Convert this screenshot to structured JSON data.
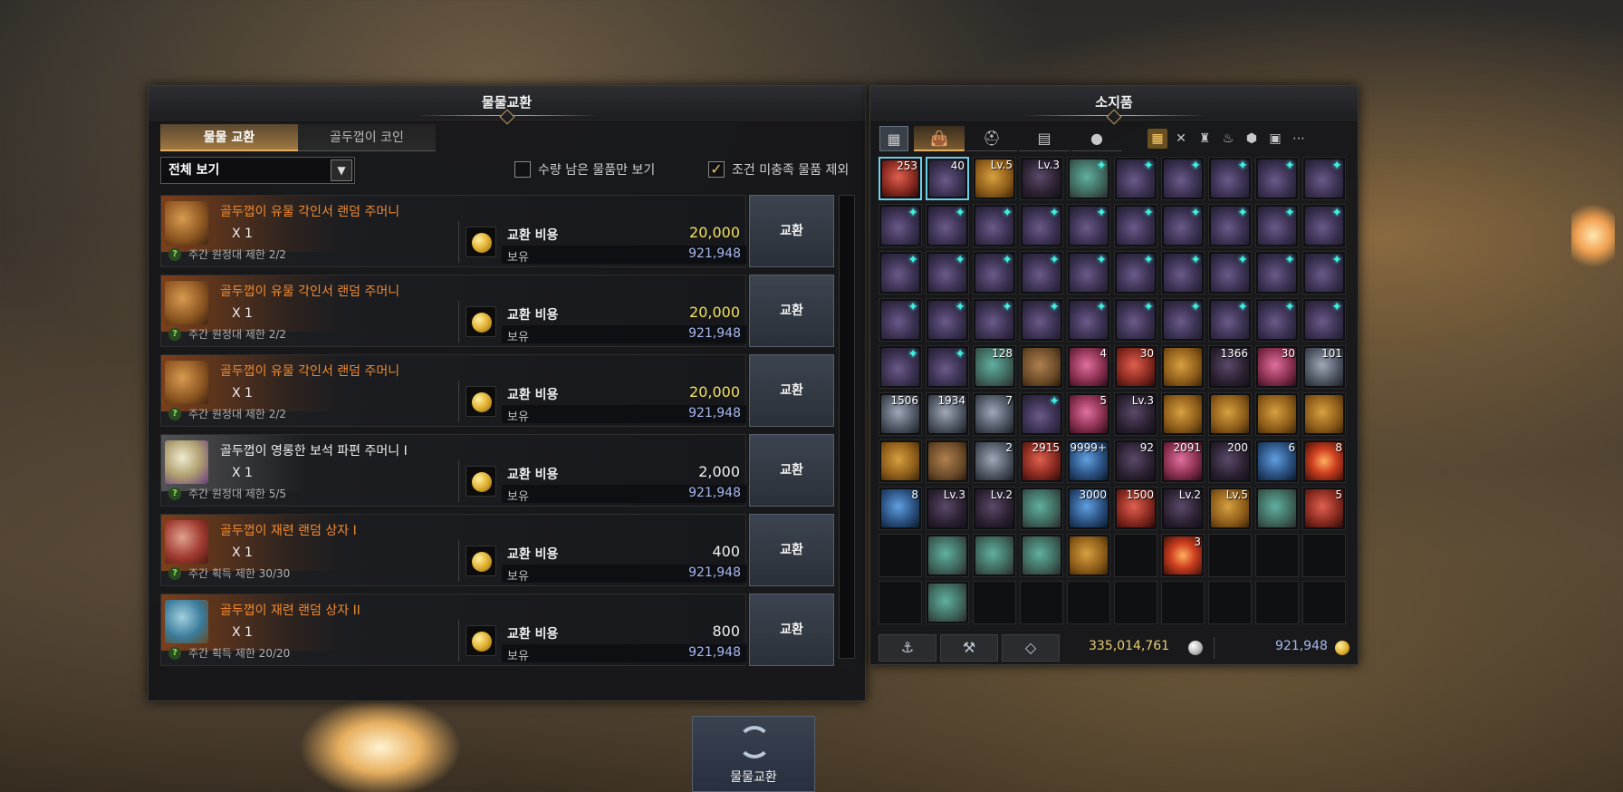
{
  "barter_panel": {
    "title": "물물교환",
    "tabs": [
      "물물 교환",
      "골두껍이 코인"
    ],
    "filter_selected": "전체 보기",
    "check_remaining_only": {
      "label": "수량 남은 물품만 보기",
      "checked": false
    },
    "check_exclude_unmet": {
      "label": "조건 미충족 물품 제외",
      "checked": true
    },
    "cost_label": "교환 비용",
    "own_label": "보유",
    "exchange_button": "교환",
    "items": [
      {
        "name": "골두껍이 유물 각인서 랜덤 주머니",
        "qty": "X 1",
        "limit": "주간 원정대 제한 2/2",
        "cost": "20,000",
        "owned": "921,948",
        "icon": "pouch-icon",
        "rarity": "orange"
      },
      {
        "name": "골두껍이 유물 각인서 랜덤 주머니",
        "qty": "X 1",
        "limit": "주간 원정대 제한 2/2",
        "cost": "20,000",
        "owned": "921,948",
        "icon": "pouch-icon",
        "rarity": "orange"
      },
      {
        "name": "골두껍이 유물 각인서 랜덤 주머니",
        "qty": "X 1",
        "limit": "주간 원정대 제한 2/2",
        "cost": "20,000",
        "owned": "921,948",
        "icon": "pouch-icon",
        "rarity": "orange"
      },
      {
        "name": "골두껍이 영롱한 보석 파편 주머니 I",
        "qty": "X 1",
        "limit": "주간 원정대 제한 5/5",
        "cost": "2,000",
        "owned": "921,948",
        "icon": "gem-chest-icon",
        "rarity": "white"
      },
      {
        "name": "골두껍이 재련 랜덤 상자 I",
        "qty": "X 1",
        "limit": "주간 획득 제한 30/30",
        "cost": "400",
        "owned": "921,948",
        "icon": "red-chest-icon",
        "rarity": "orange"
      },
      {
        "name": "골두껍이 재련 랜덤 상자 II",
        "qty": "X 1",
        "limit": "주간 획득 제한 20/20",
        "cost": "800",
        "owned": "921,948",
        "icon": "blue-chest-icon",
        "rarity": "orange"
      }
    ],
    "barter_button_label": "물물교환"
  },
  "inventory_panel": {
    "title": "소지품",
    "silver": "335,014,761",
    "gold_coin": "921,948",
    "slots": [
      [
        "253:red:sel",
        "40:purple:sel",
        "Lv.5:gold",
        "Lv.3:dark",
        "*:teal",
        "*:purple",
        "*:purple",
        "*:purple",
        "*:purple",
        "*:purple"
      ],
      [
        "*:purple",
        "*:purple",
        "*:purple",
        "*:purple",
        "*:purple",
        "*:purple",
        "*:purple",
        "*:purple",
        "*:purple",
        "*:purple"
      ],
      [
        "*:purple",
        "*:purple",
        "*:purple",
        "*:purple",
        "*:purple",
        "*:purple",
        "*:purple",
        "*:purple",
        "*:purple",
        "*:purple"
      ],
      [
        "*:purple",
        "*:purple",
        "*:purple",
        "*:purple",
        "*:purple",
        "*:purple",
        "*:purple",
        "*:purple",
        "*:purple",
        "*:purple"
      ],
      [
        "*:purple",
        "*:purple",
        "128:teal",
        ":brown",
        "4:pink",
        "30:red",
        ":gold",
        "1366:dark",
        "30:pink",
        "101:chest"
      ],
      [
        "1506:chest",
        "1934:chest",
        "7:chest",
        "*:purple",
        "5:pink",
        "Lv.3:dark",
        ":gold",
        ":gold",
        ":gold",
        ":gold"
      ],
      [
        ":gold",
        ":brown",
        "2:chest",
        "2915:red",
        "9999+:blue",
        "92:dark",
        "2091:pink",
        "200:dark",
        "6:blue",
        "8:fire"
      ],
      [
        "8:blue",
        "Lv.3:dark",
        "Lv.2:dark",
        ":teal",
        "3000:blue",
        "1500:red",
        "Lv.2:dark",
        "Lv.5:gold",
        ":teal",
        "5:red"
      ],
      [
        "empty",
        ":teal",
        ":teal",
        ":teal",
        ":gold",
        "empty",
        "3:fire",
        "empty",
        "empty",
        "empty"
      ],
      [
        "empty",
        ":teal",
        "empty",
        "empty",
        "empty",
        "empty",
        "empty",
        "empty",
        "empty",
        "empty"
      ]
    ]
  }
}
